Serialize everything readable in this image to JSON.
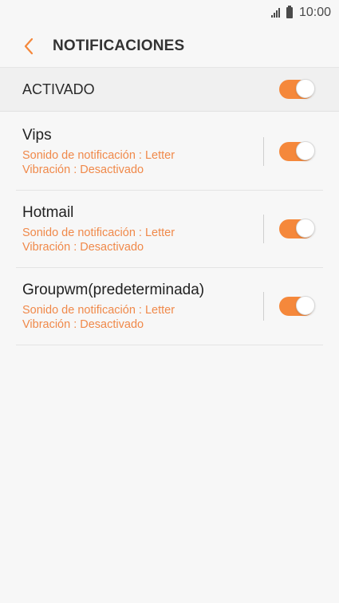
{
  "status_bar": {
    "time": "10:00",
    "signal_icon": "signal-icon",
    "battery_icon": "battery-icon"
  },
  "app_bar": {
    "title": "NOTIFICACIONES",
    "back_icon": "chevron-left-icon",
    "accent_color": "#f5883b"
  },
  "master_toggle": {
    "label": "ACTIVADO",
    "on": true
  },
  "accounts": [
    {
      "name": "Vips",
      "sound": "Sonido de notificación : Letter",
      "vibration": "Vibración : Desactivado",
      "on": true
    },
    {
      "name": "Hotmail",
      "sound": "Sonido de notificación : Letter",
      "vibration": "Vibración : Desactivado",
      "on": true
    },
    {
      "name": "Groupwm(predeterminada)",
      "sound": "Sonido de notificación : Letter",
      "vibration": "Vibración : Desactivado",
      "on": true
    }
  ]
}
